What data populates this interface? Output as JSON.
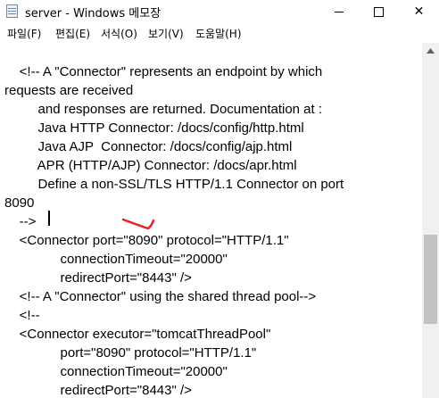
{
  "window": {
    "title": "server - Windows 메모장",
    "buttons": {
      "minimize": "minimize",
      "maximize": "maximize",
      "close": "✕"
    }
  },
  "menu": [
    {
      "label": "파일(F)"
    },
    {
      "label": "편집(E)"
    },
    {
      "label": "서식(O)"
    },
    {
      "label": "보기(V)"
    },
    {
      "label": "도움말(H)"
    }
  ],
  "editor": {
    "lines": [
      "    <!-- A \"Connector\" represents an endpoint by which",
      "requests are received",
      "         and responses are returned. Documentation at :",
      "         Java HTTP Connector: /docs/config/http.html",
      "         Java AJP  Connector: /docs/config/ajp.html",
      "         APR (HTTP/AJP) Connector: /docs/apr.html",
      "         Define a non-SSL/TLS HTTP/1.1 Connector on port",
      "8090",
      "    -->",
      "    <Connector port=\"8090\" protocol=\"HTTP/1.1\"",
      "               connectionTimeout=\"20000\"",
      "               redirectPort=\"8443\" />",
      "    <!-- A \"Connector\" using the shared thread pool-->",
      "    <!--",
      "    <Connector executor=\"tomcatThreadPool\"",
      "               port=\"8090\" protocol=\"HTTP/1.1\"",
      "               connectionTimeout=\"20000\"",
      "               redirectPort=\"8443\" />"
    ]
  },
  "colors": {
    "annotation_stroke": "#e8201f",
    "scrollbar_track": "#f0f0f0",
    "scrollbar_thumb": "#c1c1c1"
  }
}
